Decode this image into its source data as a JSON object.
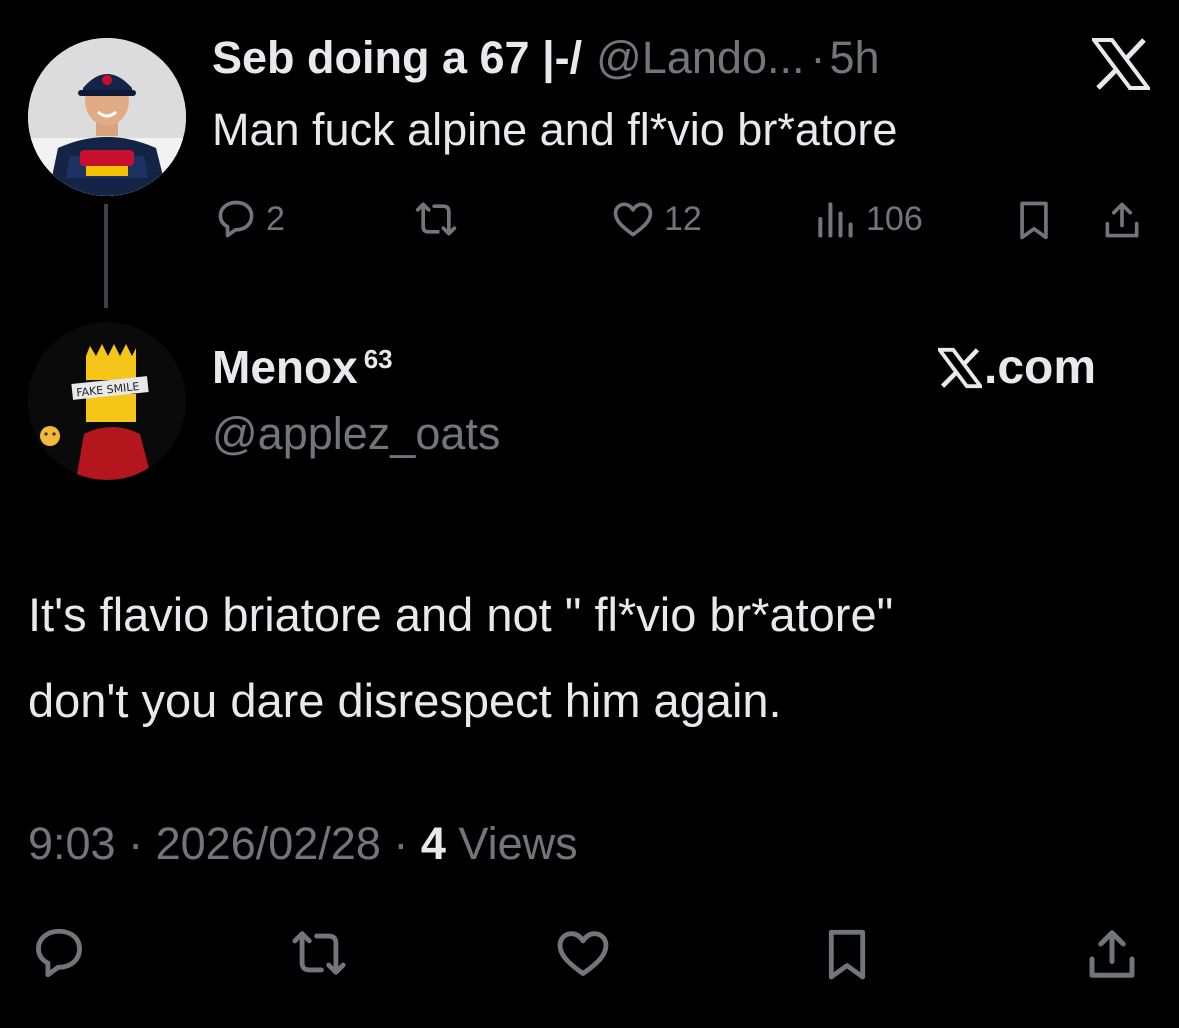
{
  "parent_tweet": {
    "display_name": "Seb doing a 67 |-/",
    "handle": "@Lando...",
    "separator": "·",
    "time": "5h",
    "text": "Man fuck alpine and fl*vio br*atore",
    "metrics": {
      "replies": "2",
      "likes": "12",
      "views": "106"
    }
  },
  "reply_card": {
    "display_name": "Menox",
    "superscript": "63",
    "handle": "@applez_oats",
    "site_label": ".com",
    "text_line1": "It's flavio briatore and not \" fl*vio br*atore\"",
    "text_line2": "don't you dare disrespect him again.",
    "time": "9:03",
    "separator1": "·",
    "date": "2026/02/28",
    "separator2": "·",
    "views_count": "4",
    "views_label": "Views"
  },
  "icons": {
    "reply": "reply-icon",
    "retweet": "retweet-icon",
    "like": "heart-icon",
    "views": "bar-chart-icon",
    "bookmark": "bookmark-icon",
    "share": "share-icon",
    "brand": "x-logo-icon"
  },
  "colors": {
    "background": "#000000",
    "primary_text": "#e7e9ea",
    "secondary_text": "#71767b",
    "thread_line": "#3e4144"
  }
}
